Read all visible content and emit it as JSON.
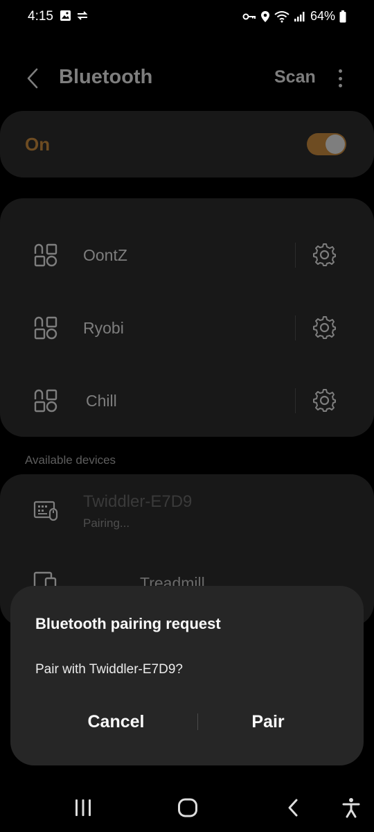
{
  "status_bar": {
    "time": "4:15",
    "battery_text": "64%",
    "icons": [
      "gallery-icon",
      "sync-icon",
      "vpn-key-icon",
      "location-icon",
      "wifi-icon",
      "signal-icon",
      "battery-icon"
    ]
  },
  "app_bar": {
    "title": "Bluetooth",
    "scan_label": "Scan",
    "icons": [
      "back-arrow-icon",
      "more-options-icon"
    ]
  },
  "bluetooth_toggle": {
    "label": "On",
    "state": "on",
    "accent_color": "#6e4c22"
  },
  "paired_devices": [
    {
      "name": "OontZ",
      "icon": "device-generic-icon",
      "settings_icon": "gear-icon"
    },
    {
      "name": "Ryobi",
      "icon": "device-generic-icon",
      "settings_icon": "gear-icon"
    },
    {
      "name": "Chill",
      "icon": "device-generic-icon",
      "settings_icon": "gear-icon"
    }
  ],
  "available_section": {
    "header": "Available devices",
    "devices": [
      {
        "name": "Twiddler-E7D9",
        "status": "Pairing...",
        "icon": "keyboard-mouse-icon"
      },
      {
        "name": "Treadmill",
        "icon": "device-screen-icon"
      }
    ]
  },
  "dialog": {
    "title": "Bluetooth pairing request",
    "message": "Pair with Twiddler-E7D9?",
    "cancel_label": "Cancel",
    "pair_label": "Pair"
  },
  "nav_bar": {
    "icons": [
      "recents-icon",
      "home-icon",
      "back-icon",
      "accessibility-icon"
    ]
  }
}
